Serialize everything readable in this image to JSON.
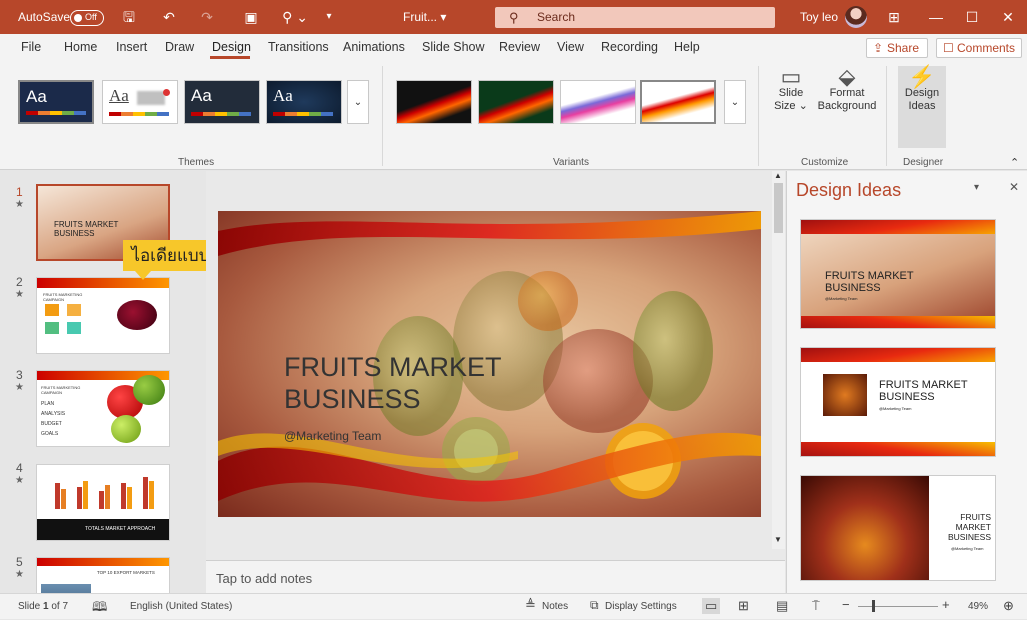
{
  "titlebar": {
    "autosave_label": "AutoSave",
    "autosave_state": "Off",
    "filename": "Fruit...",
    "search_placeholder": "Search",
    "user_name": "Toy leo"
  },
  "menu": {
    "items": [
      "File",
      "Home",
      "Insert",
      "Draw",
      "Design",
      "Transitions",
      "Animations",
      "Slide Show",
      "Review",
      "View",
      "Recording",
      "Help"
    ],
    "active": "Design",
    "share_label": "Share",
    "comments_label": "Comments"
  },
  "ribbon": {
    "themes_label": "Themes",
    "theme_samples": [
      "Aa",
      "Aa",
      "Aa",
      "Aa"
    ],
    "variants_label": "Variants",
    "customize_label": "Customize",
    "designer_label": "Designer",
    "slide_size_label": "Slide Size",
    "format_background_label": "Format Background",
    "design_ideas_label": "Design Ideas"
  },
  "slides": {
    "numbers": [
      "1",
      "2",
      "3",
      "4",
      "5"
    ],
    "tooltip_text": "ไอเดียแบบเดิม",
    "thumb1_title": "FRUITS MARKET BUSINESS",
    "thumb2_title": "FRUITS MARKETING CAMPAIGN",
    "thumb3_title": "FRUITS MARKETING CAMPAIGN",
    "thumb3_items": [
      "PLAN",
      "ANALYSIS",
      "BUDGET",
      "GOALS"
    ],
    "thumb4_title": "TOTALS MARKET APPROACH",
    "thumb5_title": "TOP 10 EXPORT MARKETS"
  },
  "main_slide": {
    "title_line1": "FRUITS MARKET",
    "title_line2": "BUSINESS",
    "subtitle": "@Marketing Team"
  },
  "notes_placeholder": "Tap to add notes",
  "design_ideas": {
    "title": "Design Ideas",
    "idea_title": "FRUITS MARKET BUSINESS",
    "idea_subtitle": "@Marketing Team"
  },
  "statusbar": {
    "slide_label": "Slide",
    "slide_current": "1",
    "slide_of": "of 7",
    "language": "English (United States)",
    "notes_label": "Notes",
    "display_settings_label": "Display Settings",
    "zoom_percent": "49%"
  },
  "colors": {
    "accent": "#b7472a",
    "tooltip": "#f7c72a"
  }
}
